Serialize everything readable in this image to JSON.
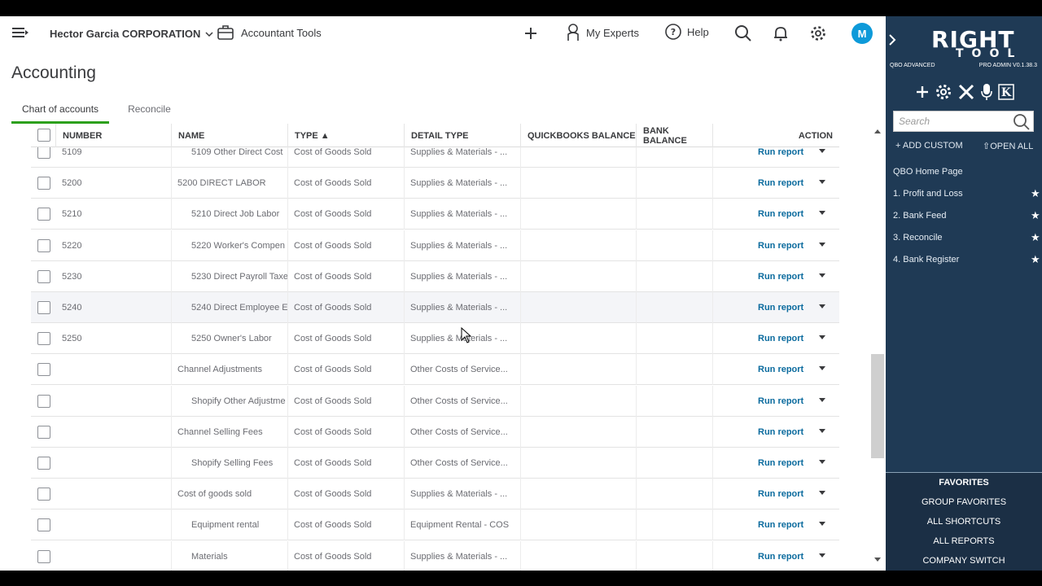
{
  "header": {
    "company": "Hector Garcia CORPORATION",
    "accountant_tools": "Accountant Tools",
    "my_experts": "My Experts",
    "help": "Help",
    "avatar_letter": "M"
  },
  "page": {
    "title": "Accounting",
    "tabs": [
      {
        "label": "Chart of accounts",
        "active": true
      },
      {
        "label": "Reconcile",
        "active": false
      }
    ]
  },
  "table": {
    "columns": {
      "number": "NUMBER",
      "name": "NAME",
      "type": "TYPE ▲",
      "detail_type": "DETAIL TYPE",
      "qb_balance": "QUICKBOOKS BALANCE",
      "bank_balance": "BANK BALANCE",
      "action": "ACTION"
    },
    "run_report_label": "Run report",
    "rows": [
      {
        "number": "5109",
        "name": "5109 Other Direct Cost",
        "type": "Cost of Goods Sold",
        "detail": "Supplies & Materials - ..."
      },
      {
        "number": "5200",
        "name": "5200 DIRECT LABOR",
        "type": "Cost of Goods Sold",
        "detail": "Supplies & Materials - ..."
      },
      {
        "number": "5210",
        "name": "5210 Direct Job Labor",
        "type": "Cost of Goods Sold",
        "detail": "Supplies & Materials - ..."
      },
      {
        "number": "5220",
        "name": "5220 Worker's Compen",
        "type": "Cost of Goods Sold",
        "detail": "Supplies & Materials - ..."
      },
      {
        "number": "5230",
        "name": "5230 Direct Payroll Taxe",
        "type": "Cost of Goods Sold",
        "detail": "Supplies & Materials - ..."
      },
      {
        "number": "5240",
        "name": "5240 Direct Employee E",
        "type": "Cost of Goods Sold",
        "detail": "Supplies & Materials - ..."
      },
      {
        "number": "5250",
        "name": "5250 Owner's Labor",
        "type": "Cost of Goods Sold",
        "detail": "Supplies & Materials - ..."
      },
      {
        "number": "",
        "name": "Channel Adjustments",
        "type": "Cost of Goods Sold",
        "detail": "Other Costs of Service..."
      },
      {
        "number": "",
        "name": "Shopify Other Adjustme",
        "type": "Cost of Goods Sold",
        "detail": "Other Costs of Service..."
      },
      {
        "number": "",
        "name": "Channel Selling Fees",
        "type": "Cost of Goods Sold",
        "detail": "Other Costs of Service..."
      },
      {
        "number": "",
        "name": "Shopify Selling Fees",
        "type": "Cost of Goods Sold",
        "detail": "Other Costs of Service..."
      },
      {
        "number": "",
        "name": "Cost of goods sold",
        "type": "Cost of Goods Sold",
        "detail": "Supplies & Materials - ..."
      },
      {
        "number": "",
        "name": "Equipment rental",
        "type": "Cost of Goods Sold",
        "detail": "Equipment Rental - COS"
      },
      {
        "number": "",
        "name": "Materials",
        "type": "Cost of Goods Sold",
        "detail": "Supplies & Materials - ..."
      }
    ]
  },
  "sidebar": {
    "logo_top": "RIGHT",
    "logo_bottom": "TOOL",
    "left_tag": "QBO ADVANCED",
    "right_tag": "PRO ADMIN V0.1.38.3",
    "search_placeholder": "Search",
    "add_custom": "+ ADD CUSTOM",
    "open_all": "⇧OPEN ALL",
    "home": "QBO Home Page",
    "items": [
      "1. Profit and Loss",
      "2. Bank Feed",
      "3. Reconcile",
      "4. Bank Register"
    ],
    "favorites_title": "FAVORITES",
    "group_favorites": "GROUP FAVORITES",
    "all_shortcuts": "ALL SHORTCUTS",
    "all_reports": "ALL REPORTS",
    "company_switch": "COMPANY SWITCH"
  }
}
